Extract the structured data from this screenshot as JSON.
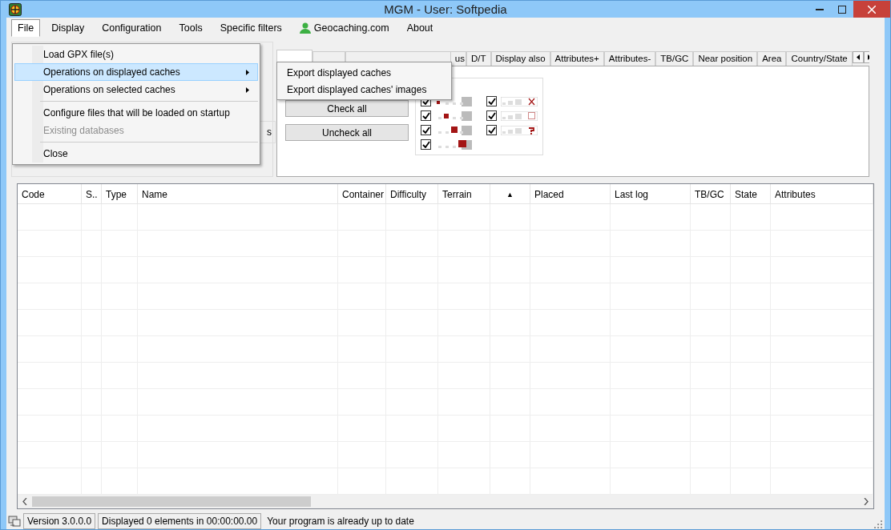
{
  "window": {
    "title": "MGM - User: Softpedia"
  },
  "menu_bar": [
    {
      "label": "File",
      "selected": true
    },
    {
      "label": "Display",
      "selected": false
    },
    {
      "label": "Configuration",
      "selected": false
    },
    {
      "label": "Tools",
      "selected": false
    },
    {
      "label": "Specific filters",
      "selected": false
    },
    {
      "label": "Geocaching.com",
      "selected": false,
      "kind": "user"
    },
    {
      "label": "About",
      "selected": false
    }
  ],
  "file_menu": [
    {
      "label": "Load GPX file(s)",
      "selected": false,
      "submenu": false,
      "disabled": false
    },
    {
      "label": "Operations on displayed caches",
      "selected": true,
      "submenu": true,
      "disabled": false
    },
    {
      "label": "Operations on selected caches",
      "selected": false,
      "submenu": true,
      "disabled": false
    },
    {
      "kind": "separator"
    },
    {
      "label": "Configure files that will be loaded on startup",
      "selected": false,
      "submenu": false,
      "disabled": false
    },
    {
      "label": "Existing databases",
      "selected": false,
      "submenu": false,
      "disabled": true
    },
    {
      "kind": "separator"
    },
    {
      "label": "Close",
      "selected": false,
      "submenu": false,
      "disabled": false
    }
  ],
  "submenu": [
    "Export displayed caches",
    "Export displayed caches' images"
  ],
  "left_panel": {
    "button_fragment": "s"
  },
  "tabs": [
    {
      "selected": true
    },
    {
      "selected": false
    },
    {
      "selected": false
    },
    {
      "label": "us",
      "selected": false
    },
    {
      "label": "D/T",
      "selected": false
    },
    {
      "label": "Display also",
      "selected": false
    },
    {
      "label": "Attributes+",
      "selected": false
    },
    {
      "label": "Attributes-",
      "selected": false
    },
    {
      "label": "TB/GC",
      "selected": false
    },
    {
      "label": "Near position",
      "selected": false
    },
    {
      "label": "Area",
      "selected": false
    },
    {
      "label": "Country/State",
      "selected": false
    }
  ],
  "buttons": [
    "Check all",
    "Uncheck all"
  ],
  "size_filters": [
    {
      "checked": true
    },
    {
      "checked": true
    },
    {
      "checked": true
    },
    {
      "checked": true
    },
    {
      "checked": true
    },
    {
      "checked": true
    },
    {
      "checked": true
    }
  ],
  "table": {
    "columns": [
      "Code",
      "S..",
      "Type",
      "Name",
      "Container",
      "Difficulty",
      "Terrain",
      "▲",
      "Placed",
      "Last log",
      "TB/GC",
      "State",
      "Attributes"
    ]
  },
  "status_bar": [
    "Version 3.0.0.0",
    "Displayed 0 elements in 00:00:00.00",
    "Your program is already up to date"
  ]
}
